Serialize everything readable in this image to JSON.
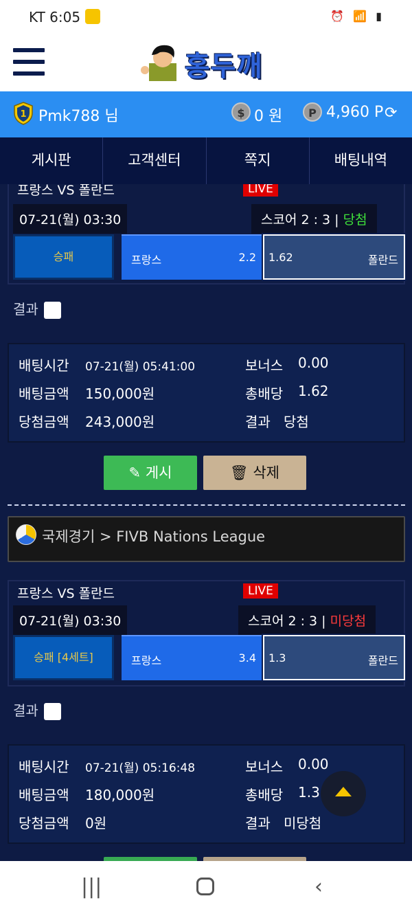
{
  "status": {
    "carrier": "KT 6:05"
  },
  "header": {
    "logo_text": "홍두깨"
  },
  "user": {
    "name": "Pmk788 님",
    "money": "0 원",
    "points": "4,960 P"
  },
  "nav": {
    "tabs": [
      "게시판",
      "고객센터",
      "쪽지",
      "배팅내역"
    ]
  },
  "colors": {
    "accent": "#2b8ef2",
    "win": "#3fe13a",
    "lose": "#ff3b3b",
    "live": "#e00000"
  },
  "bets": [
    {
      "match": "프랑스 VS 폴란드",
      "live": "LIVE",
      "time": "07-21(월) 03:30",
      "score": "스코어 2 : 3 |",
      "score_result": "당첨",
      "type": "승패",
      "opt1_name": "프랑스",
      "opt1_odds": "2.2",
      "opt2_odds": "1.62",
      "opt2_name": "폴란드",
      "result_label": "결과",
      "bet_time_label": "배팅시간",
      "bet_time": "07-21(월) 05:41:00",
      "bonus_label": "보너스",
      "bonus": "0.00",
      "amount_label": "배팅금액",
      "amount": "150,000원",
      "total_odds_label": "총배당",
      "total_odds": "1.62",
      "win_amount_label": "당첨금액",
      "win_amount": "243,000원",
      "result_text_label": "결과",
      "result_text": "당첨",
      "post_label": "게시",
      "delete_label": "삭제"
    },
    {
      "league": "국제경기 > FIVB Nations League",
      "match": "프랑스 VS 폴란드",
      "live": "LIVE",
      "time": "07-21(월) 03:30",
      "score": "스코어 2 : 3 |",
      "score_result": "미당첨",
      "type": "승패 [4세트]",
      "opt1_name": "프랑스",
      "opt1_odds": "3.4",
      "opt2_odds": "1.3",
      "opt2_name": "폴란드",
      "result_label": "결과",
      "bet_time_label": "배팅시간",
      "bet_time": "07-21(월) 05:16:48",
      "bonus_label": "보너스",
      "bonus": "0.00",
      "amount_label": "배팅금액",
      "amount": "180,000원",
      "total_odds_label": "총배당",
      "total_odds": "1.3",
      "win_amount_label": "당첨금액",
      "win_amount": "0원",
      "result_text_label": "결과",
      "result_text": "미당첨"
    }
  ]
}
